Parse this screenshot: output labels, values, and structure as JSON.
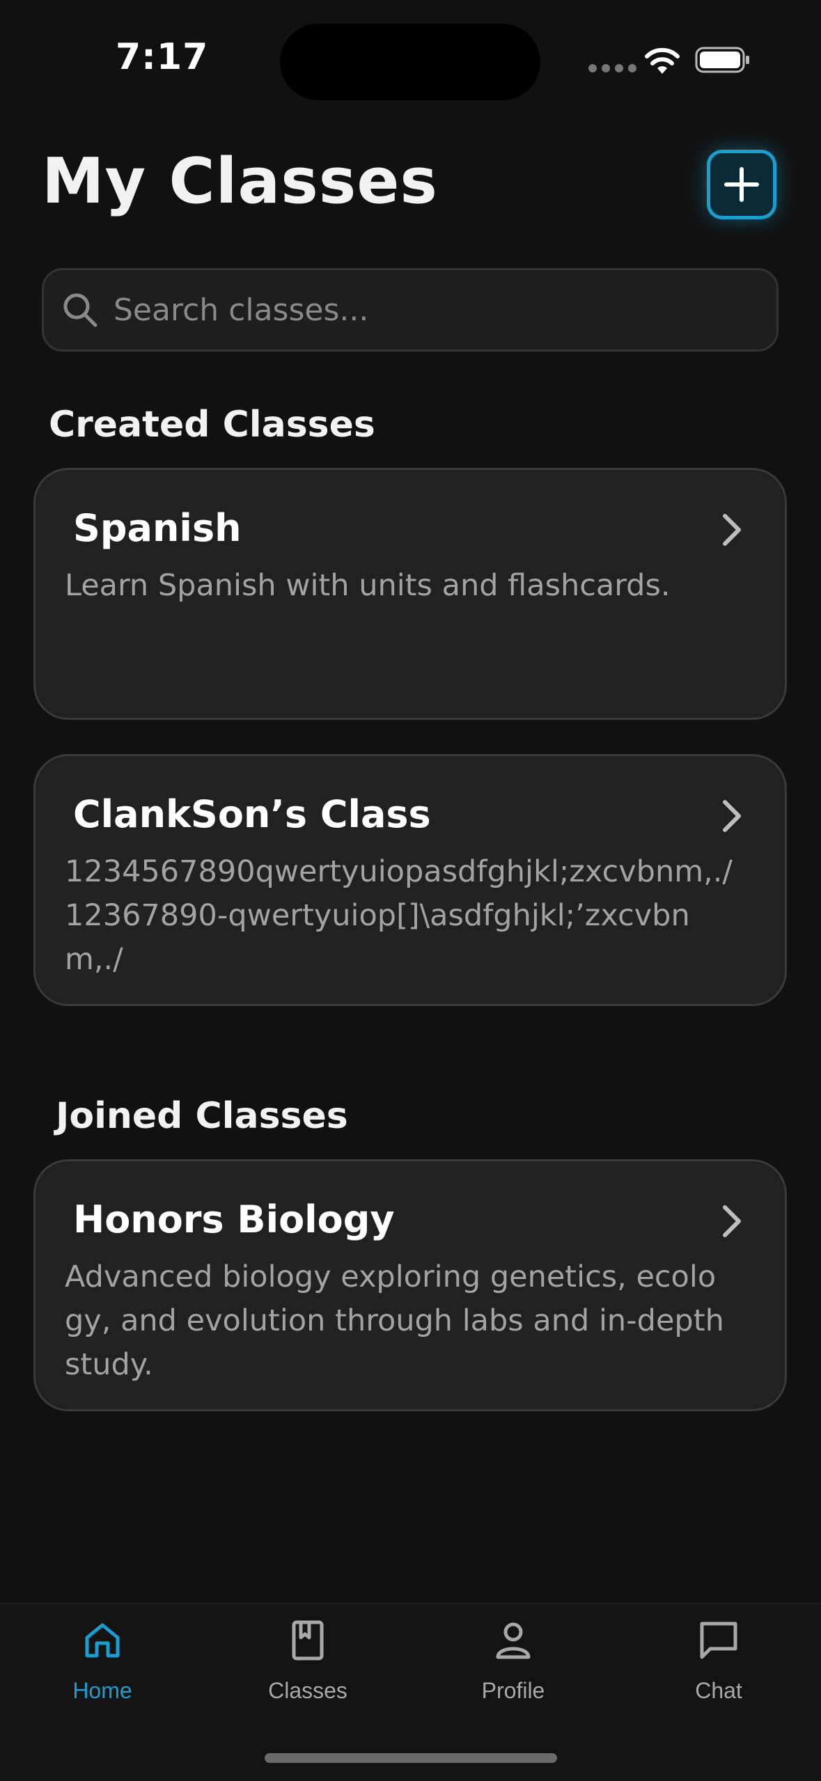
{
  "status_bar": {
    "time": "7:17"
  },
  "header": {
    "title": "My Classes",
    "add_button_label": "+"
  },
  "search": {
    "placeholder": "Search classes...",
    "value": ""
  },
  "sections": {
    "created": {
      "heading": "Created Classes",
      "classes": [
        {
          "title": "Spanish",
          "description": "Learn Spanish with units and flashcards."
        },
        {
          "title": "ClankSon’s Class",
          "description": "1234567890qwertyuiopasdfghjkl;zxcvbnm,./12367890-qwertyuiop[]\\asdfghjkl;’zxcvbnm,./"
        }
      ]
    },
    "joined": {
      "heading": "Joined Classes",
      "classes": [
        {
          "title": "Honors Biology",
          "description": "Advanced biology exploring genetics, ecology, and evolution through labs and in-depth study."
        }
      ]
    }
  },
  "tab_bar": {
    "tabs": [
      {
        "label": "Home",
        "icon": "home-icon",
        "active": true
      },
      {
        "label": "Classes",
        "icon": "book-icon",
        "active": false
      },
      {
        "label": "Profile",
        "icon": "person-icon",
        "active": false
      },
      {
        "label": "Chat",
        "icon": "chat-bubble-icon",
        "active": false
      }
    ]
  },
  "colors": {
    "background": "#111111",
    "card": "#212121",
    "accent": "#1a9ecf",
    "muted_text": "#a3a3a3"
  }
}
